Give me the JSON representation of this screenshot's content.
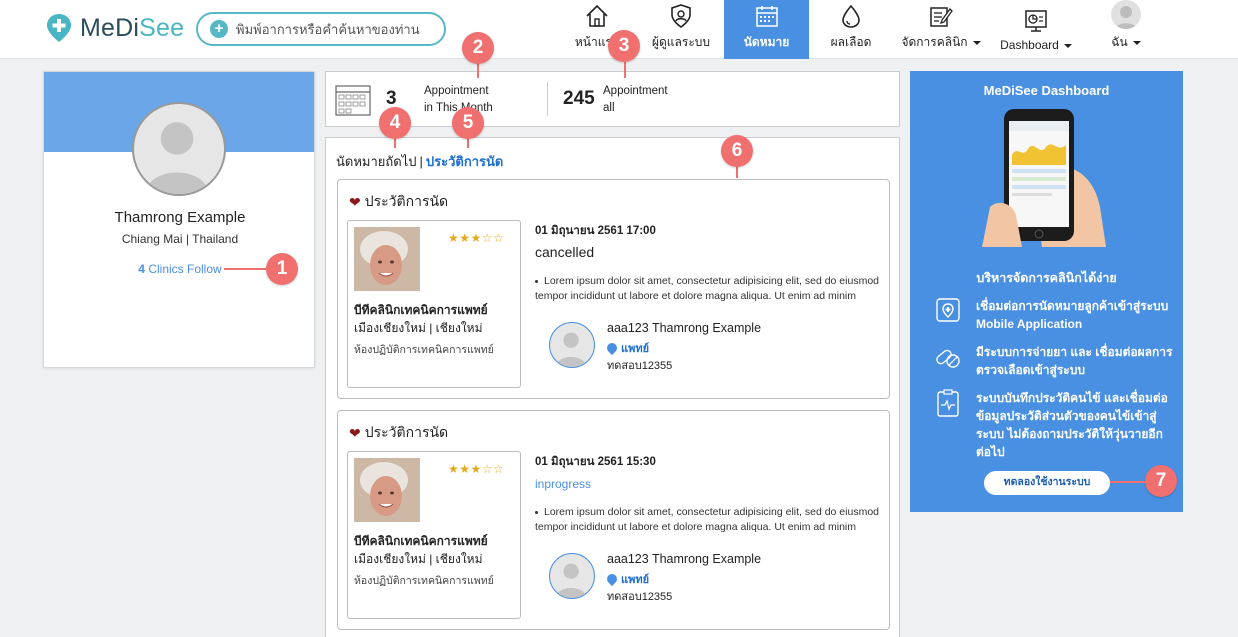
{
  "brand": {
    "name_prefix": "MeDi",
    "name_suffix": "See"
  },
  "search": {
    "placeholder": "พิมพ์อาการหรือคำค้นหาของท่าน"
  },
  "nav": [
    {
      "label": "หน้าแรก",
      "icon": "home-icon"
    },
    {
      "label": "ผู้ดูแลระบบ",
      "icon": "admin-shield-icon"
    },
    {
      "label": "นัดหมาย",
      "icon": "calendar-icon",
      "active": true
    },
    {
      "label": "ผลเลือด",
      "icon": "blood-drop-icon"
    },
    {
      "label": "จัดการคลินิก",
      "icon": "edit-clinic-icon"
    },
    {
      "label": "Dashboard",
      "icon": "dashboard-icon"
    },
    {
      "label": "ฉัน",
      "icon": "user-avatar"
    }
  ],
  "profile": {
    "name": "Thamrong Example",
    "location": "Chiang Mai | Thailand",
    "follow_count": "4",
    "follow_label": "Clinics Follow"
  },
  "stats": {
    "month_count": "3",
    "month_label_1": "Appointment",
    "month_label_2": "in This Month",
    "all_count": "245",
    "all_label_1": "Appointment",
    "all_label_2": "all"
  },
  "tabs": {
    "upcoming": "นัดหมายถัดไป",
    "separator": "|",
    "history": "ประวัติการนัด"
  },
  "appointments": [
    {
      "header": "ประวัติการนัด",
      "rating": "★★★☆☆",
      "clinic_name": "บีทีคลินิกเทคนิคการแพทย์",
      "clinic_city": "เมืองเชียงใหม่ | เชียงใหม่",
      "clinic_type": "ห้องปฏิบัติการเทคนิคการแพทย์",
      "datetime": "01 มิถุนายน 2561 17:00",
      "status": "cancelled",
      "description": "Lorem ipsum dolor sit amet, consectetur adipisicing elit, sed do eiusmod tempor incididunt ut labore et dolore magna aliqua. Ut enim ad minim",
      "doctor_name": "aaa123 Thamrong Example",
      "doctor_role": "แพทย์",
      "doctor_note": "ทดสอบ12355"
    },
    {
      "header": "ประวัติการนัด",
      "rating": "★★★☆☆",
      "clinic_name": "บีทีคลินิกเทคนิคการแพทย์",
      "clinic_city": "เมืองเชียงใหม่ | เชียงใหม่",
      "clinic_type": "ห้องปฏิบัติการเทคนิคการแพทย์",
      "datetime": "01 มิถุนายน 2561 15:30",
      "status": "inprogress",
      "description": "Lorem ipsum dolor sit amet, consectetur adipisicing elit, sed do eiusmod tempor incididunt ut labore et dolore magna aliqua. Ut enim ad minim",
      "doctor_name": "aaa123 Thamrong Example",
      "doctor_role": "แพทย์",
      "doctor_note": "ทดสอบ12355"
    }
  ],
  "promo": {
    "title": "MeDiSee Dashboard",
    "heading": "บริหารจัดการคลินิกได้ง่าย",
    "features": [
      "เชื่อมต่อการนัดหมายลูกค้าเข้าสู่ระบบ Mobile Application",
      "มีระบบการจ่ายยา และ เชื่อมต่อผลการตรวจเลือดเข้าสู่ระบบ",
      "ระบบบันทึกประวัติคนไข้ และเชื่อมต่อข้อมูลประวัติส่วนตัวของคนไข้เข้าสู่ระบบ ไม่ต้องถามประวัติให้วุ่นวายอีกต่อไป"
    ],
    "button": "ทดลองใช้งานระบบ"
  },
  "callouts": [
    "1",
    "2",
    "3",
    "4",
    "5",
    "6",
    "7"
  ],
  "colors": {
    "accent": "#4a90e2",
    "brand_teal": "#4ab5c3",
    "callout": "#f07070",
    "heart": "#8b1b1b"
  }
}
